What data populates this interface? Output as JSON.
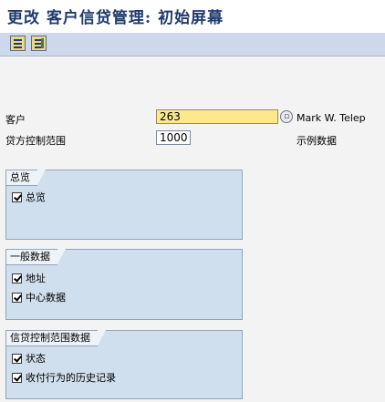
{
  "window": {
    "title": "更改 客户信贷管理: 初始屏幕"
  },
  "toolbar": {
    "buttons": [
      {
        "icon": "display-icon"
      },
      {
        "icon": "change-icon"
      }
    ]
  },
  "form": {
    "customer_label": "客户",
    "customer_value": "263",
    "customer_name": "Mark W. Telep",
    "credit_area_label": "贷方控制范围",
    "credit_area_value": "1000",
    "credit_area_desc": "示例数据"
  },
  "groups": [
    {
      "title": "总览",
      "items": [
        {
          "label": "总览",
          "checked": true
        }
      ]
    },
    {
      "title": "一般数据",
      "items": [
        {
          "label": "地址",
          "checked": true
        },
        {
          "label": "中心数据",
          "checked": true
        }
      ]
    },
    {
      "title": "信贷控制范围数据",
      "items": [
        {
          "label": "状态",
          "checked": true
        },
        {
          "label": "收付行为的历史记录",
          "checked": true
        }
      ]
    }
  ]
}
